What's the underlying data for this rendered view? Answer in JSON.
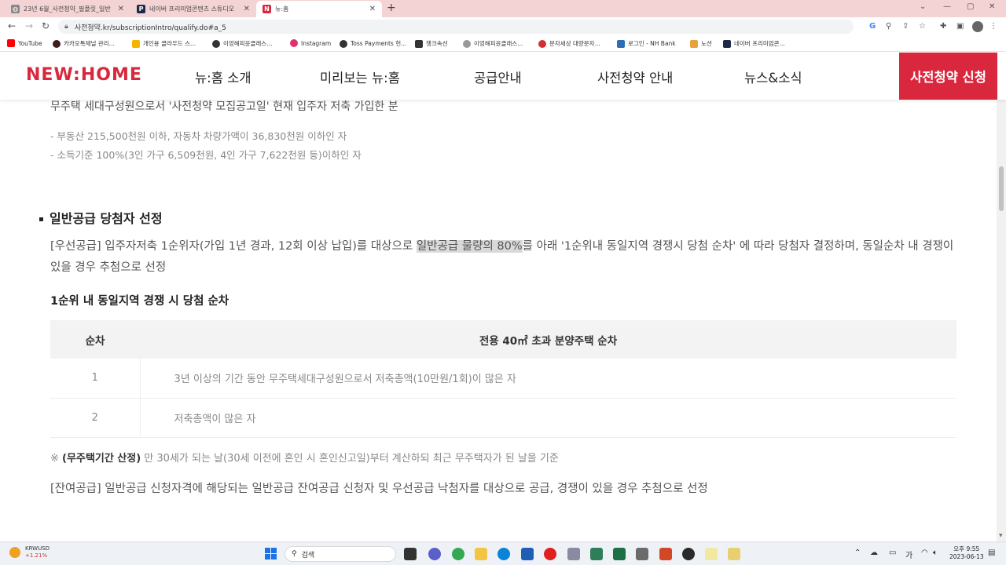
{
  "browser": {
    "tabs": [
      {
        "title": "23년 6월_사전청약_필플릿_일반",
        "favicon": "globe-icon",
        "active": false
      },
      {
        "title": "네이버 프리미엄콘텐츠 스튜디오",
        "favicon": "P",
        "active": false
      },
      {
        "title": "뉴:홈",
        "favicon": "N",
        "active": true
      }
    ],
    "url": "사전청약.kr/subscriptionIntro/qualify.do#a_5",
    "bookmarks": [
      {
        "label": "YouTube",
        "color": "#ff0000"
      },
      {
        "label": "카카오톡채널 관리...",
        "color": "#3c1e1e"
      },
      {
        "label": "개인용 클라우드 스...",
        "color": "#f4b400"
      },
      {
        "label": "이엉해피윤클래스...",
        "color": "#333333"
      },
      {
        "label": "Instagram",
        "color": "#e1306c"
      },
      {
        "label": "Toss Payments 헌...",
        "color": "#333333"
      },
      {
        "label": "챙크속선",
        "color": "#333333"
      },
      {
        "label": "이엉해피윤클래스...",
        "color": "#999999"
      },
      {
        "label": "문자세상 대량문자...",
        "color": "#d32f2f"
      },
      {
        "label": "로그인 - NH Bank",
        "color": "#2d6db4"
      },
      {
        "label": "노션",
        "color": "#e6a23c"
      },
      {
        "label": "네이버 프리미엄콘...",
        "color": "#1e2a4a"
      }
    ]
  },
  "site": {
    "logo": "NEW:HOME",
    "nav": [
      "뉴:홈 소개",
      "미리보는 뉴:홈",
      "공급안내",
      "사전청약 안내",
      "뉴스&소식"
    ],
    "cta_label": "사전청약 신청",
    "accent_color": "#d9283e"
  },
  "content": {
    "cut_line": "무주택 세대구성원으로서 '사전청약 모집공고일' 현재 입주자 저축 가입한 분",
    "conditions": [
      "- 부동산 215,500천원 이하, 자동차 차량가액이 36,830천원 이하인 자",
      "- 소득기준 100%(3인 가구 6,509천원, 4인 가구 7,622천원 등)이하인 자"
    ],
    "section_title": "일반공급 당첨자 선정",
    "priority_pre": "[우선공급] 입주자저축 1순위자(가입 1년 경과, 12회 이상 납입)를 대상으로 ",
    "priority_hl": "일반공급 물량의 80%",
    "priority_post": "를 아래 '1순위내 동일지역 경쟁시 당첨 순차' 에 따라 당첨자 결정하며, 동일순차 내 경쟁이 있을 경우 추첨으로 선정",
    "sub_title": "1순위 내 동일지역 경쟁 시 당첨 순차",
    "table": {
      "headers": [
        "순차",
        "전용 40㎡ 초과 분양주택 순차"
      ],
      "rows": [
        [
          "1",
          "3년 이상의 기간 동안 무주택세대구성원으로서 저축총액(10만원/1회)이 많은 자"
        ],
        [
          "2",
          "저축총액이 많은 자"
        ]
      ]
    },
    "note_prefix": "※ ",
    "note_bold": "(무주택기간 산정)",
    "note_text": " 만 30세가 되는 날(30세 이전에 혼인 시 혼인신고일)부터 계산하되 최근 무주택자가 된 날을 기준",
    "remainder": "[잔여공급] 일반공급 신청자격에 해당되는 일반공급 잔여공급 신청자 및 우선공급 낙첨자를 대상으로 공급, 경쟁이 있을 경우 추첨으로 선정"
  },
  "taskbar": {
    "weather_label": "KRWUSD",
    "weather_change": "+1.21%",
    "search_placeholder": "검색",
    "clock_time": "오후 9:55",
    "clock_date": "2023-06-13",
    "ime": "가"
  }
}
